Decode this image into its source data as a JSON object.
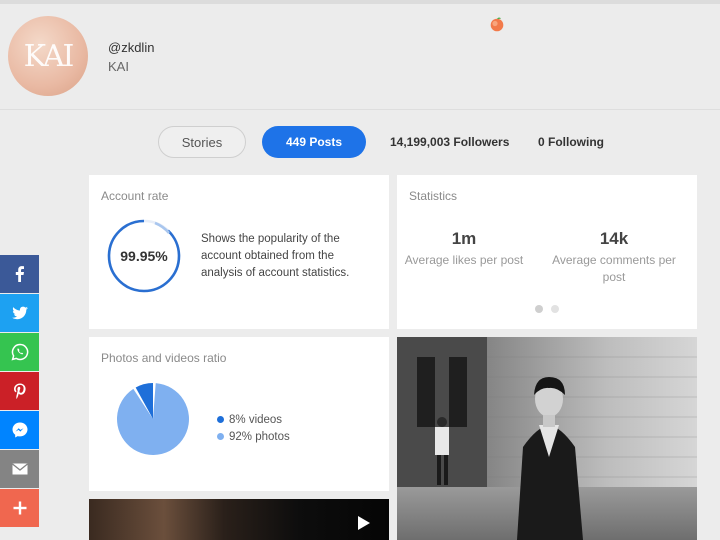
{
  "profile": {
    "avatar_text": "KAI",
    "username": "@zkdlin",
    "display_name": "KAI",
    "decoration_icon": "peach-icon"
  },
  "stats_bar": {
    "stories_label": "Stories",
    "posts_label": "449 Posts",
    "followers_label": "14,199,003 Followers",
    "following_label": "0 Following",
    "accent_color": "#1e73e8"
  },
  "account_rate": {
    "title": "Account rate",
    "value_text": "99.95%",
    "value": 99.95,
    "description": "Shows the popularity of the account obtained from the analysis of account statistics."
  },
  "statistics": {
    "title": "Statistics",
    "items": [
      {
        "value": "1m",
        "label": "Average likes per post"
      },
      {
        "value": "14k",
        "label": "Average comments per post"
      }
    ],
    "pager_count": 2,
    "pager_active": 0
  },
  "media_ratio": {
    "title": "Photos and videos ratio",
    "legend": [
      {
        "label": "8% videos",
        "value": 8,
        "color": "#1e6fd9"
      },
      {
        "label": "92% photos",
        "value": 92,
        "color": "#7fb0f0"
      }
    ]
  },
  "posts": {
    "video_icon": "play-icon"
  },
  "share_bar": [
    {
      "name": "facebook-icon",
      "color": "#3b5998"
    },
    {
      "name": "twitter-icon",
      "color": "#1da1f2"
    },
    {
      "name": "whatsapp-icon",
      "color": "#35c450"
    },
    {
      "name": "pinterest-icon",
      "color": "#cb2027"
    },
    {
      "name": "messenger-icon",
      "color": "#0084ff"
    },
    {
      "name": "email-icon",
      "color": "#848484"
    },
    {
      "name": "more-share-icon",
      "color": "#f0674f"
    }
  ]
}
